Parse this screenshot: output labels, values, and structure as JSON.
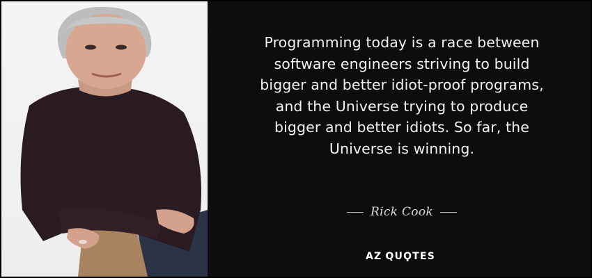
{
  "quote": {
    "text_lines": [
      "Programming today is a race between",
      "software engineers striving to build",
      "bigger and better idiot-proof programs,",
      "and the Universe trying to produce",
      "bigger and better idiots. So far, the",
      "Universe is winning."
    ]
  },
  "author": {
    "name": "Rick Cook"
  },
  "brand": {
    "prefix": "AZ",
    "name": "QUOTES",
    "display_name": "QUϘTES"
  },
  "colors": {
    "background": "#0d0d0d",
    "quote_text": "#f2f2f2",
    "author_text": "#d8d8d8",
    "photo_background": "#f0f0f0",
    "sweater": "#2a1a22"
  },
  "icons": {
    "portrait": "portrait-photo"
  }
}
